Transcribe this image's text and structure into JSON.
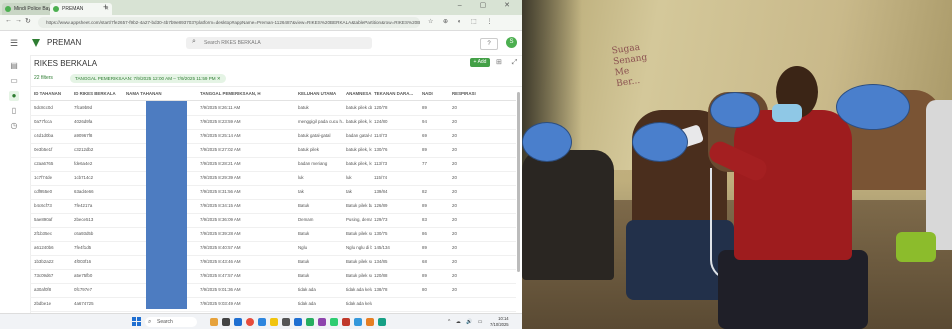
{
  "browser": {
    "tabs": [
      {
        "label": "Mindi Police Bayom"
      },
      {
        "label": "PREMAN"
      }
    ],
    "new_tab": "+",
    "window_controls": "– ▢ ✕",
    "url": "https://www.appsheet.com/start/7fe2657-f9b2-4a27-bd30-4b7b9e893703?platform=desktop#appName=Preman-1126487&view=RIKES%20BERKALA&tablePartition&row=RIKES%20BERKALA"
  },
  "app": {
    "name": "PREMAN",
    "search_placeholder": "Search RIKES BERKALA",
    "help": "?",
    "avatar_initial": "S"
  },
  "sidebar": [
    {
      "name": "menu-icon"
    },
    {
      "name": "folder-icon"
    },
    {
      "name": "person-icon"
    },
    {
      "name": "document-icon"
    },
    {
      "name": "clock-icon"
    },
    {
      "name": "table-icon"
    }
  ],
  "view": {
    "title": "RIKES BERKALA",
    "add_label": "+ Add",
    "filter_count": "22 filters",
    "filter_chip": "TANGGAL PEMERIKSAAN: 7/9/2025 12:00 AM – 7/9/2025 11:59 PM  ✕"
  },
  "table": {
    "columns": [
      "ID TAHANAN",
      "ID RIKES BERKALA",
      "NAMA TAHANAN",
      "TANGGAL PEMERIKSAAN, H",
      "KELUHAN UTAMA",
      "ANAMNESA",
      "TEKANAN DARA...",
      "NADI",
      "RESPIRASI"
    ],
    "rows": [
      [
        "5dc8cc0d",
        "7fca9b9d",
        "",
        "7/9/2025 8:26:11 AM",
        "batuk",
        "batuk pilek dan 3 ha...",
        "120/78",
        "89",
        "20"
      ],
      [
        "0a77fcca",
        "4026d9fa",
        "",
        "7/9/2025 8:23:59 AM",
        "menggigil pada cucu h...",
        "batuk pilek, kul...",
        "124/80",
        "94",
        "20"
      ],
      [
        "c4d1d0ba",
        "a90967f8",
        "",
        "7/9/2025 8:25:14 AM",
        "batuk gatal-gatal",
        "badan gatal-anyr...",
        "114/73",
        "69",
        "20"
      ],
      [
        "0e3b5e1f",
        "c3212db2",
        "",
        "7/9/2025 8:27:02 AM",
        "batuk pilek",
        "batuk pilek, kul...",
        "130/76",
        "89",
        "20"
      ],
      [
        "c2aa6765",
        "fde6a4e2",
        "",
        "7/9/2025 8:28:21 AM",
        "badan meriang",
        "batuk pilek, kul...",
        "113/73",
        "77",
        "20"
      ],
      [
        "1c7f74de",
        "1cb714c2",
        "",
        "7/9/2025 8:29:39 AM",
        "luk",
        "luk",
        "115/74",
        "",
        "20"
      ],
      [
        "cdf955e0",
        "63ad4e66",
        "",
        "7/9/2025 8:31:56 AM",
        "tak",
        "tak",
        "139/84",
        "82",
        "20"
      ],
      [
        "b4c6cf73",
        "7fe4217a",
        "",
        "7/9/2025 8:34:15 AM",
        "Batuk",
        "Batuk pilek bat 3a...",
        "126/89",
        "89",
        "20"
      ],
      [
        "5ae890af",
        "2bece513",
        "",
        "7/9/2025 8:36:09 AM",
        "Demam",
        "Pusing, demam ...",
        "129/73",
        "83",
        "20"
      ],
      [
        "2f1b35ec",
        "c6a93d5b",
        "",
        "7/9/2025 8:39:28 AM",
        "Batuk",
        "Batuk pilek sulu...",
        "130/75",
        "86",
        "20"
      ],
      [
        "a61240b6",
        "7fe4f1d5",
        "",
        "7/9/2025 8:40:57 AM",
        "Nglu",
        "Nglu nglu di ba...",
        "145/134",
        "89",
        "20"
      ],
      [
        "1b3b2a22",
        "4f003f16",
        "",
        "7/9/2025 8:43:46 AM",
        "Batuk",
        "Batuk pilek sulu...",
        "134/85",
        "68",
        "20"
      ],
      [
        "73c09d67",
        "a5e75fb0",
        "",
        "7/9/2025 8:47:57 AM",
        "Batuk",
        "Batuk pilek sulu...",
        "120/88",
        "89",
        "20"
      ],
      [
        "a30af0f8",
        "0fc797e7",
        "",
        "7/9/2025 9:01:36 AM",
        "tidak ada",
        "tidak ada keluhan",
        "138/78",
        "80",
        "20"
      ],
      [
        "2bdbe1e",
        "4a674725",
        "",
        "7/9/2025 9:03:49 AM",
        "tidak ada",
        "tidak ada keluhan",
        "",
        "",
        ""
      ]
    ]
  },
  "taskbar": {
    "search_label": "Search",
    "tray": "^ ☁ 🔊 ▭",
    "time": "10:14",
    "date": "7/10/2025"
  },
  "photo": {
    "wall_writing": "Sugaa\nSenang\nMe\nBer..."
  }
}
